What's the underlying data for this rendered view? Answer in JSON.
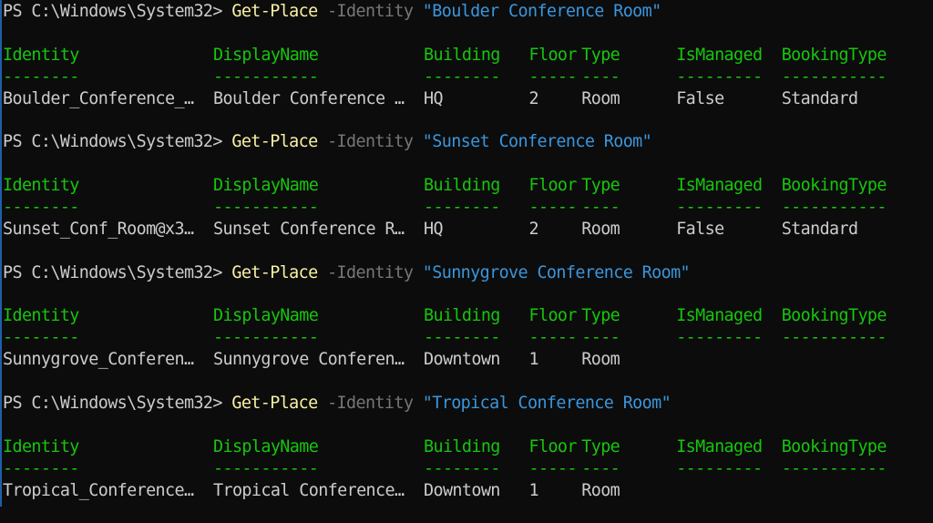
{
  "prompt": "PS C:\\Windows\\System32> ",
  "command": "Get-Place",
  "parameter": "-Identity",
  "columns": [
    "Identity",
    "DisplayName",
    "Building",
    "Floor",
    "Type",
    "IsManaged",
    "BookingType"
  ],
  "underlines": [
    "--------",
    "-----------",
    "--------",
    "-----",
    "----",
    "---------",
    "-----------"
  ],
  "blocks": [
    {
      "arg": "\"Boulder Conference Room\"",
      "row": [
        "Boulder_Conference_…",
        "Boulder Conference …",
        "HQ",
        "2",
        "Room",
        "False",
        "Standard"
      ]
    },
    {
      "arg": "\"Sunset Conference Room\"",
      "row": [
        "Sunset_Conf_Room@x3…",
        "Sunset Conference R…",
        "HQ",
        "2",
        "Room",
        "False",
        "Standard"
      ]
    },
    {
      "arg": "\"Sunnygrove Conference Room\"",
      "row": [
        "Sunnygrove_Conferen…",
        "Sunnygrove Conferen…",
        "Downtown",
        "1",
        "Room",
        "",
        ""
      ]
    },
    {
      "arg": "\"Tropical Conference Room\"",
      "row": [
        "Tropical_Conference…",
        "Tropical Conference…",
        "Downtown",
        "1",
        "Room",
        "",
        ""
      ]
    }
  ]
}
